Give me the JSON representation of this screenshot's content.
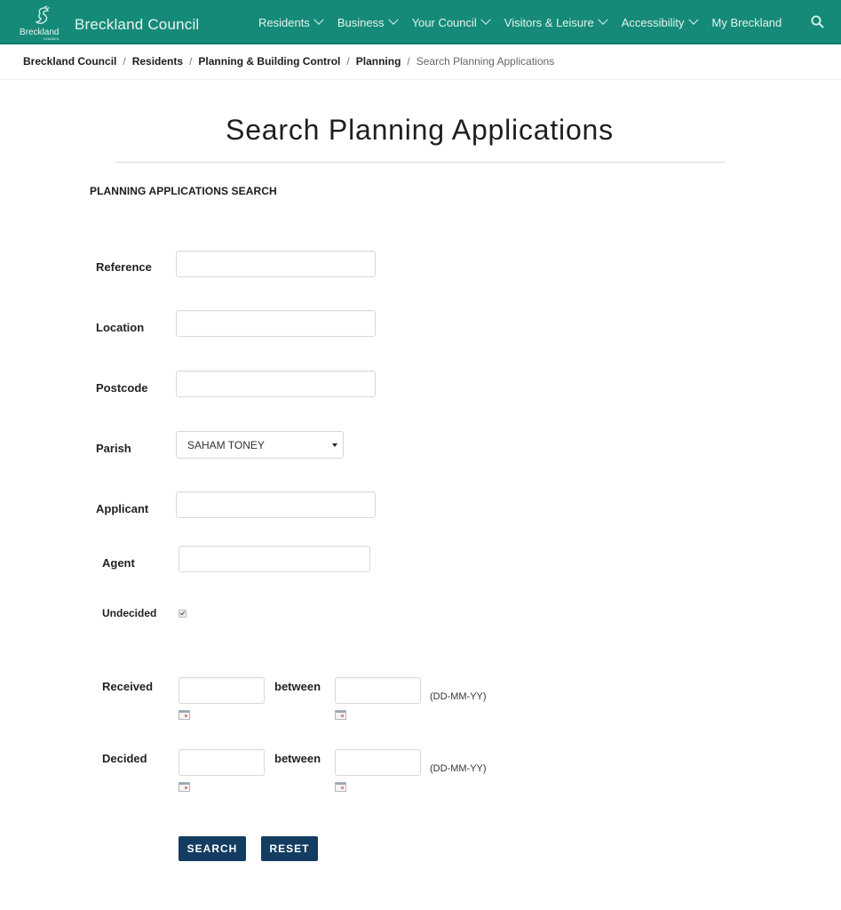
{
  "header": {
    "brand_logo_text": "Breckland",
    "brand_logo_subtext": "COUNCIL",
    "brand_name": "Breckland Council",
    "nav": [
      {
        "label": "Residents",
        "has_dropdown": true
      },
      {
        "label": "Business",
        "has_dropdown": true
      },
      {
        "label": "Your Council",
        "has_dropdown": true
      },
      {
        "label": "Visitors & Leisure",
        "has_dropdown": true
      },
      {
        "label": "Accessibility",
        "has_dropdown": true
      },
      {
        "label": "My Breckland",
        "has_dropdown": false
      }
    ],
    "search_icon": "search-icon",
    "colors": {
      "bar": "#158a78",
      "text": "#e4f4ef"
    }
  },
  "breadcrumb": {
    "items": [
      "Breckland Council",
      "Residents",
      "Planning & Building Control",
      "Planning"
    ],
    "current": "Search Planning Applications",
    "separator": "/"
  },
  "page": {
    "title": "Search Planning Applications",
    "section_heading": "PLANNING APPLICATIONS SEARCH"
  },
  "form": {
    "reference": {
      "label": "Reference",
      "value": "",
      "placeholder": ""
    },
    "location": {
      "label": "Location",
      "value": "",
      "placeholder": ""
    },
    "postcode": {
      "label": "Postcode",
      "value": "",
      "placeholder": ""
    },
    "parish": {
      "label": "Parish",
      "selected": "SAHAM TONEY"
    },
    "applicant": {
      "label": "Applicant",
      "value": "",
      "placeholder": ""
    },
    "agent": {
      "label": "Agent",
      "value": "",
      "placeholder": ""
    },
    "undecided": {
      "label": "Undecided",
      "checked": true
    },
    "received": {
      "label": "Received",
      "between_label": "between",
      "from": "",
      "to": "",
      "format_hint": "(DD-MM-YY)"
    },
    "decided": {
      "label": "Decided",
      "between_label": "between",
      "from": "",
      "to": "",
      "format_hint": "(DD-MM-YY)"
    },
    "calendar_icon": "calendar-icon"
  },
  "actions": {
    "search_label": "SEARCH",
    "reset_label": "RESET",
    "button_color": "#133c60"
  }
}
